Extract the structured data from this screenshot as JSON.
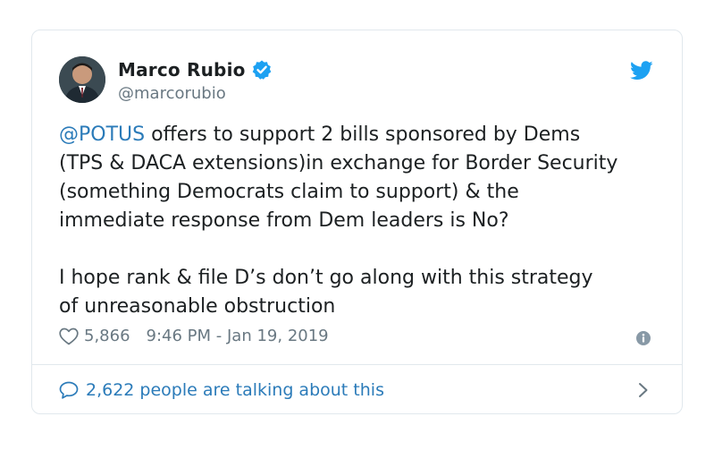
{
  "tweet": {
    "author": {
      "name": "Marco Rubio",
      "handle": "@marcorubio",
      "verified": true
    },
    "text": {
      "mention": "@POTUS",
      "line1_rest": " offers to support 2 bills sponsored by Dems",
      "line2": "(TPS & DACA extensions)in exchange for Border Security",
      "line3": "(something Democrats claim to support) & the",
      "line4": "immediate response from Dem leaders is No?",
      "line5": "I hope rank & file D’s don’t go along with this strategy",
      "line6": "of unreasonable obstruction"
    },
    "likes": "5,866",
    "timestamp": "9:46 PM - Jan 19, 2019",
    "talking": "2,622 people are talking about this"
  },
  "colors": {
    "link": "#2b7bb9",
    "twitter_blue": "#1da1f2",
    "secondary_text": "#697882",
    "border": "#e1e8ed"
  },
  "icons": [
    "verified-icon",
    "twitter-bird-icon",
    "heart-icon",
    "info-icon",
    "speech-bubble-icon",
    "chevron-right-icon"
  ]
}
